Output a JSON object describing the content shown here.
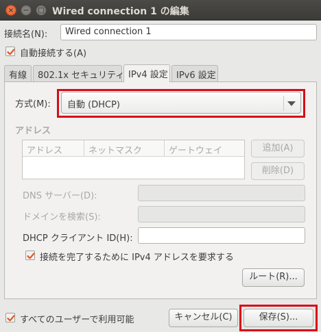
{
  "window": {
    "title": "Wired connection 1 の編集",
    "close_glyph": "×",
    "min_glyph": "−",
    "max_glyph": "□"
  },
  "connection": {
    "name_label": "接続名(N):",
    "name_value": "Wired connection 1",
    "auto_connect_label": "自動接続する(A)",
    "auto_connect_checked": true
  },
  "tabs": [
    {
      "label": "有線",
      "active": false
    },
    {
      "label": "802.1x セキュリティ",
      "active": false
    },
    {
      "label": "IPv4 設定",
      "active": true
    },
    {
      "label": "IPv6 設定",
      "active": false
    }
  ],
  "ipv4": {
    "method_label": "方式(M):",
    "method_value": "自動 (DHCP)",
    "addresses_heading": "アドレス",
    "columns": [
      "アドレス",
      "ネットマスク",
      "ゲートウェイ"
    ],
    "add_button": "追加(A)",
    "delete_button": "削除(D)",
    "dns_label": "DNS サーバー(D):",
    "search_domains_label": "ドメインを検索(S):",
    "dhcp_client_id_label": "DHCP クライアント ID(H):",
    "require_ipv4_label": "接続を完了するために IPv4 アドレスを要求する",
    "require_ipv4_checked": true,
    "routes_button": "ルート(R)..."
  },
  "footer": {
    "all_users_label": "すべてのユーザーで利用可能",
    "all_users_checked": true,
    "cancel_button": "キャンセル(C)",
    "save_button": "保存(S)..."
  },
  "colors": {
    "highlight": "#d70b17",
    "checkbox_accent": "#e2561f"
  }
}
